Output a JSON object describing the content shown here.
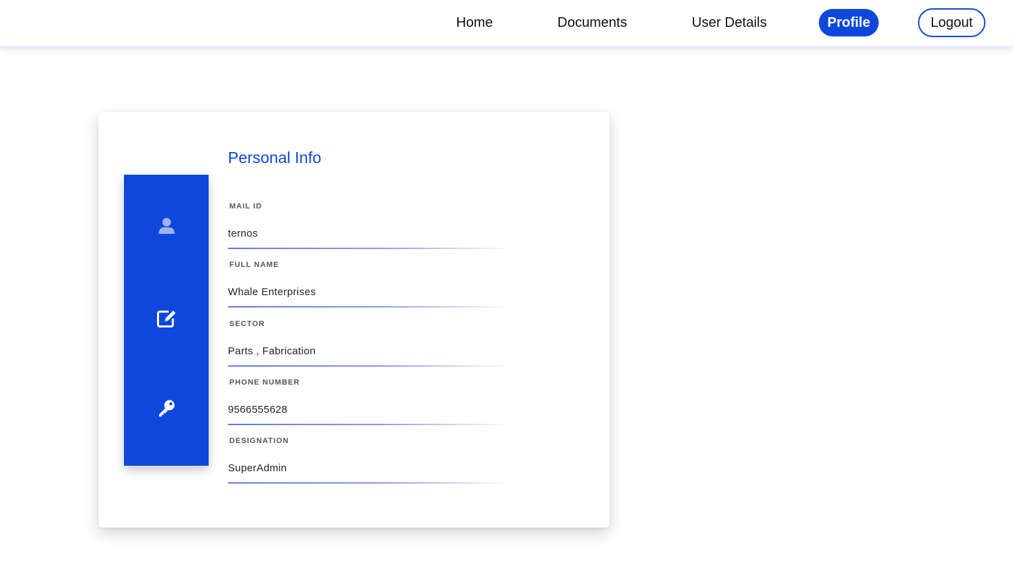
{
  "nav": {
    "home": "Home",
    "documents": "Documents",
    "user_details": "User Details",
    "profile": "Profile",
    "logout": "Logout"
  },
  "sidebar": {
    "icons": [
      "user-icon",
      "edit-icon",
      "key-icon"
    ]
  },
  "profile": {
    "title": "Personal Info",
    "fields": [
      {
        "label": "MAIL ID",
        "value": "ternos"
      },
      {
        "label": "FULL NAME",
        "value": "Whale Enterprises"
      },
      {
        "label": "SECTOR",
        "value": "Parts , Fabrication"
      },
      {
        "label": "PHONE NUMBER",
        "value": "9566555628"
      },
      {
        "label": "DESIGNATION",
        "value": "SuperAdmin"
      }
    ]
  },
  "colors": {
    "accent": "#0f47dc",
    "active_icon": "#ffffff",
    "inactive_icon": "#9fb2ef"
  }
}
